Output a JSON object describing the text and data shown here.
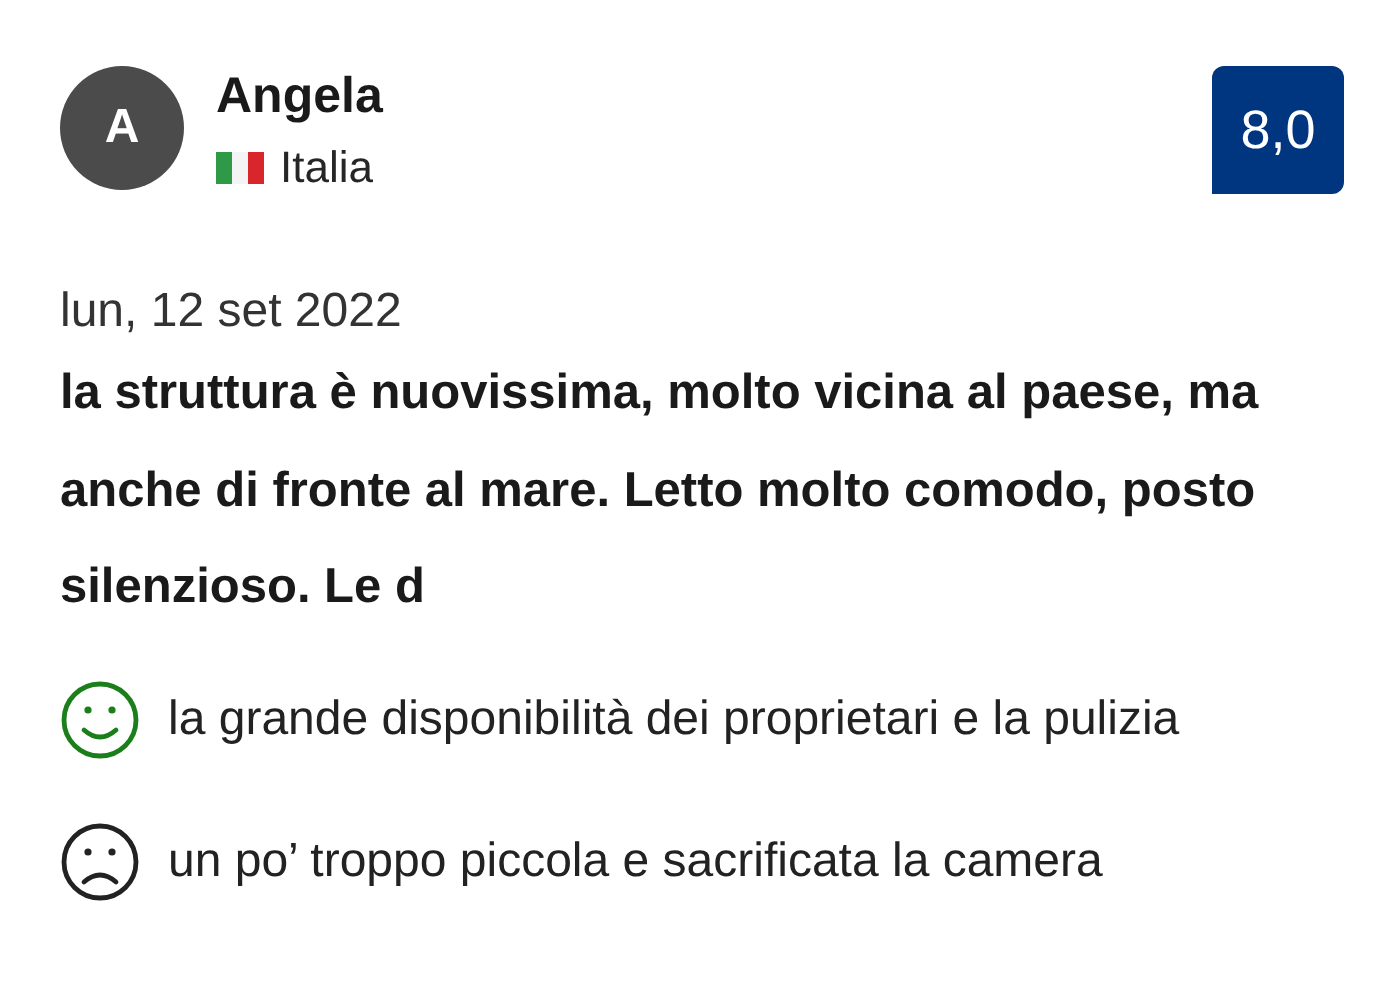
{
  "reviewer": {
    "initial": "A",
    "name": "Angela",
    "country": "Italia"
  },
  "score": "8,0",
  "date": "lun, 12 set 2022",
  "title": "la struttura è nuovissima, molto vicina al paese, ma anche di fronte al mare. Letto molto comodo, posto silenzioso. Le d",
  "comments": [
    {
      "kind": "positive",
      "text": "la grande disponibilità dei proprietari e la pulizia"
    },
    {
      "kind": "negative",
      "text": "un po’ troppo piccola e sacrificata la camera"
    }
  ]
}
